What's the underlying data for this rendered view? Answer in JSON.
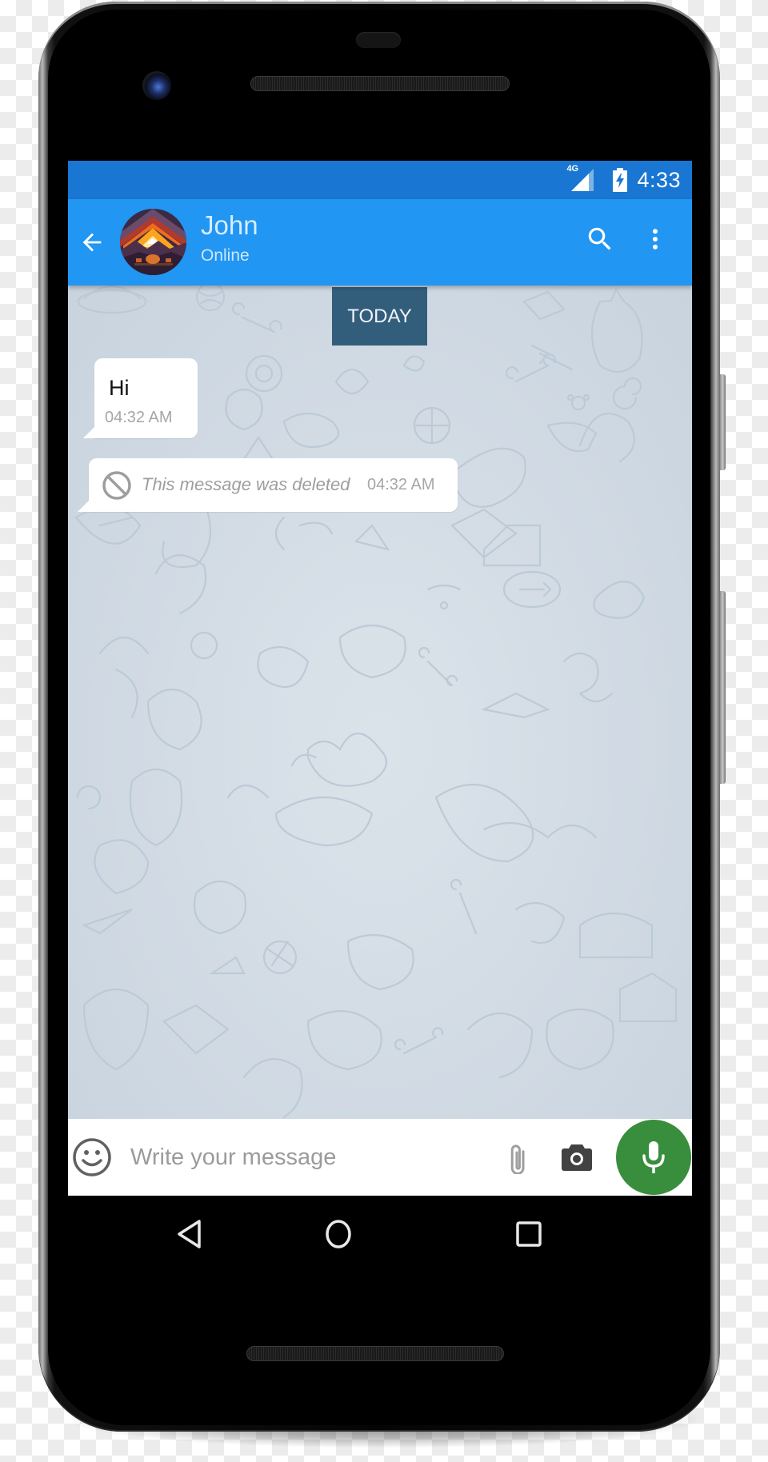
{
  "status_bar": {
    "network_label": "4G",
    "time": "4:33",
    "icons": [
      "signal-icon",
      "battery-charging-icon"
    ]
  },
  "app_bar": {
    "back_icon": "arrow-back-icon",
    "contact_name": "John",
    "contact_status": "Online",
    "actions": [
      "search-icon",
      "more-vert-icon"
    ]
  },
  "chat": {
    "date_separator": "TODAY",
    "messages": [
      {
        "text": "Hi",
        "time": "04:32 AM",
        "deleted": false
      },
      {
        "text": "This message was deleted",
        "time": "04:32 AM",
        "deleted": true,
        "icon": "block-icon"
      }
    ]
  },
  "composer": {
    "placeholder": "Write your message",
    "value": "",
    "icons": [
      "emoji-icon",
      "attach-icon",
      "camera-icon",
      "mic-icon"
    ],
    "mic_color": "#388e3c"
  },
  "nav_bar": {
    "buttons": [
      "back",
      "home",
      "recents"
    ]
  },
  "colors": {
    "status_bar": "#1976d2",
    "app_bar": "#2196f3",
    "date_chip": "#335e7b"
  }
}
